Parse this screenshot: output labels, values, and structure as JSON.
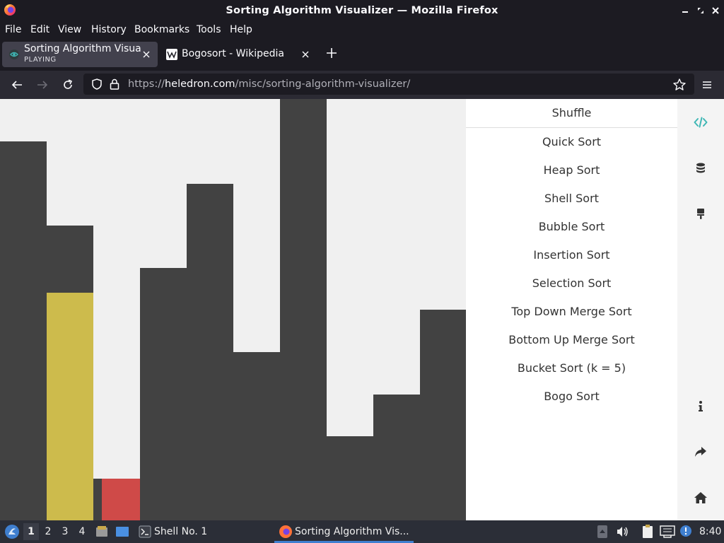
{
  "window": {
    "title": "Sorting Algorithm Visualizer — Mozilla Firefox"
  },
  "menubar": {
    "items": [
      "File",
      "Edit",
      "View",
      "History",
      "Bookmarks",
      "Tools",
      "Help"
    ]
  },
  "tabs": [
    {
      "title": "Sorting Algorithm Visualizer",
      "subtitle": "PLAYING",
      "active": true
    },
    {
      "title": "Bogosort - Wikipedia",
      "active": false
    }
  ],
  "navbar": {
    "url_prefix": "https://",
    "url_host": "heledron.com",
    "url_path": "/misc/sorting-algorithm-visualizer/"
  },
  "visualizer": {
    "bar_color": "#424242",
    "compare_color": "#cdbb4c",
    "swap_color": "#cf4a48",
    "background": "#f0f0f0",
    "bars": [
      {
        "value": 536,
        "highlight": "none"
      },
      {
        "value": 417,
        "highlight": "none"
      },
      {
        "value": 322,
        "highlight": "compare"
      },
      {
        "value": 59,
        "highlight": "none"
      },
      {
        "value": 59,
        "highlight": "swap"
      },
      {
        "value": 357,
        "highlight": "none"
      },
      {
        "value": 476,
        "highlight": "none"
      },
      {
        "value": 238,
        "highlight": "none"
      },
      {
        "value": 596,
        "highlight": "none"
      },
      {
        "value": 119,
        "highlight": "none"
      },
      {
        "value": 178,
        "highlight": "none"
      },
      {
        "value": 298,
        "highlight": "none"
      }
    ]
  },
  "algorithm_menu": {
    "shuffle_label": "Shuffle",
    "items": [
      "Quick Sort",
      "Heap Sort",
      "Shell Sort",
      "Bubble Sort",
      "Insertion Sort",
      "Selection Sort",
      "Top Down Merge Sort",
      "Bottom Up Merge Sort",
      "Bucket Sort (k = 5)",
      "Bogo Sort"
    ]
  },
  "side_icons": {
    "accent": "#3fb7b5",
    "top": [
      "code-icon",
      "database-icon",
      "paint-brush-icon"
    ],
    "bottom": [
      "info-icon",
      "share-icon",
      "home-icon"
    ]
  },
  "taskbar": {
    "workspaces": [
      "1",
      "2",
      "3",
      "4"
    ],
    "active_workspace": "1",
    "terminal_label": "Shell No. 1",
    "firefox_label": "Sorting Algorithm Vis...",
    "clock": "8:40"
  }
}
